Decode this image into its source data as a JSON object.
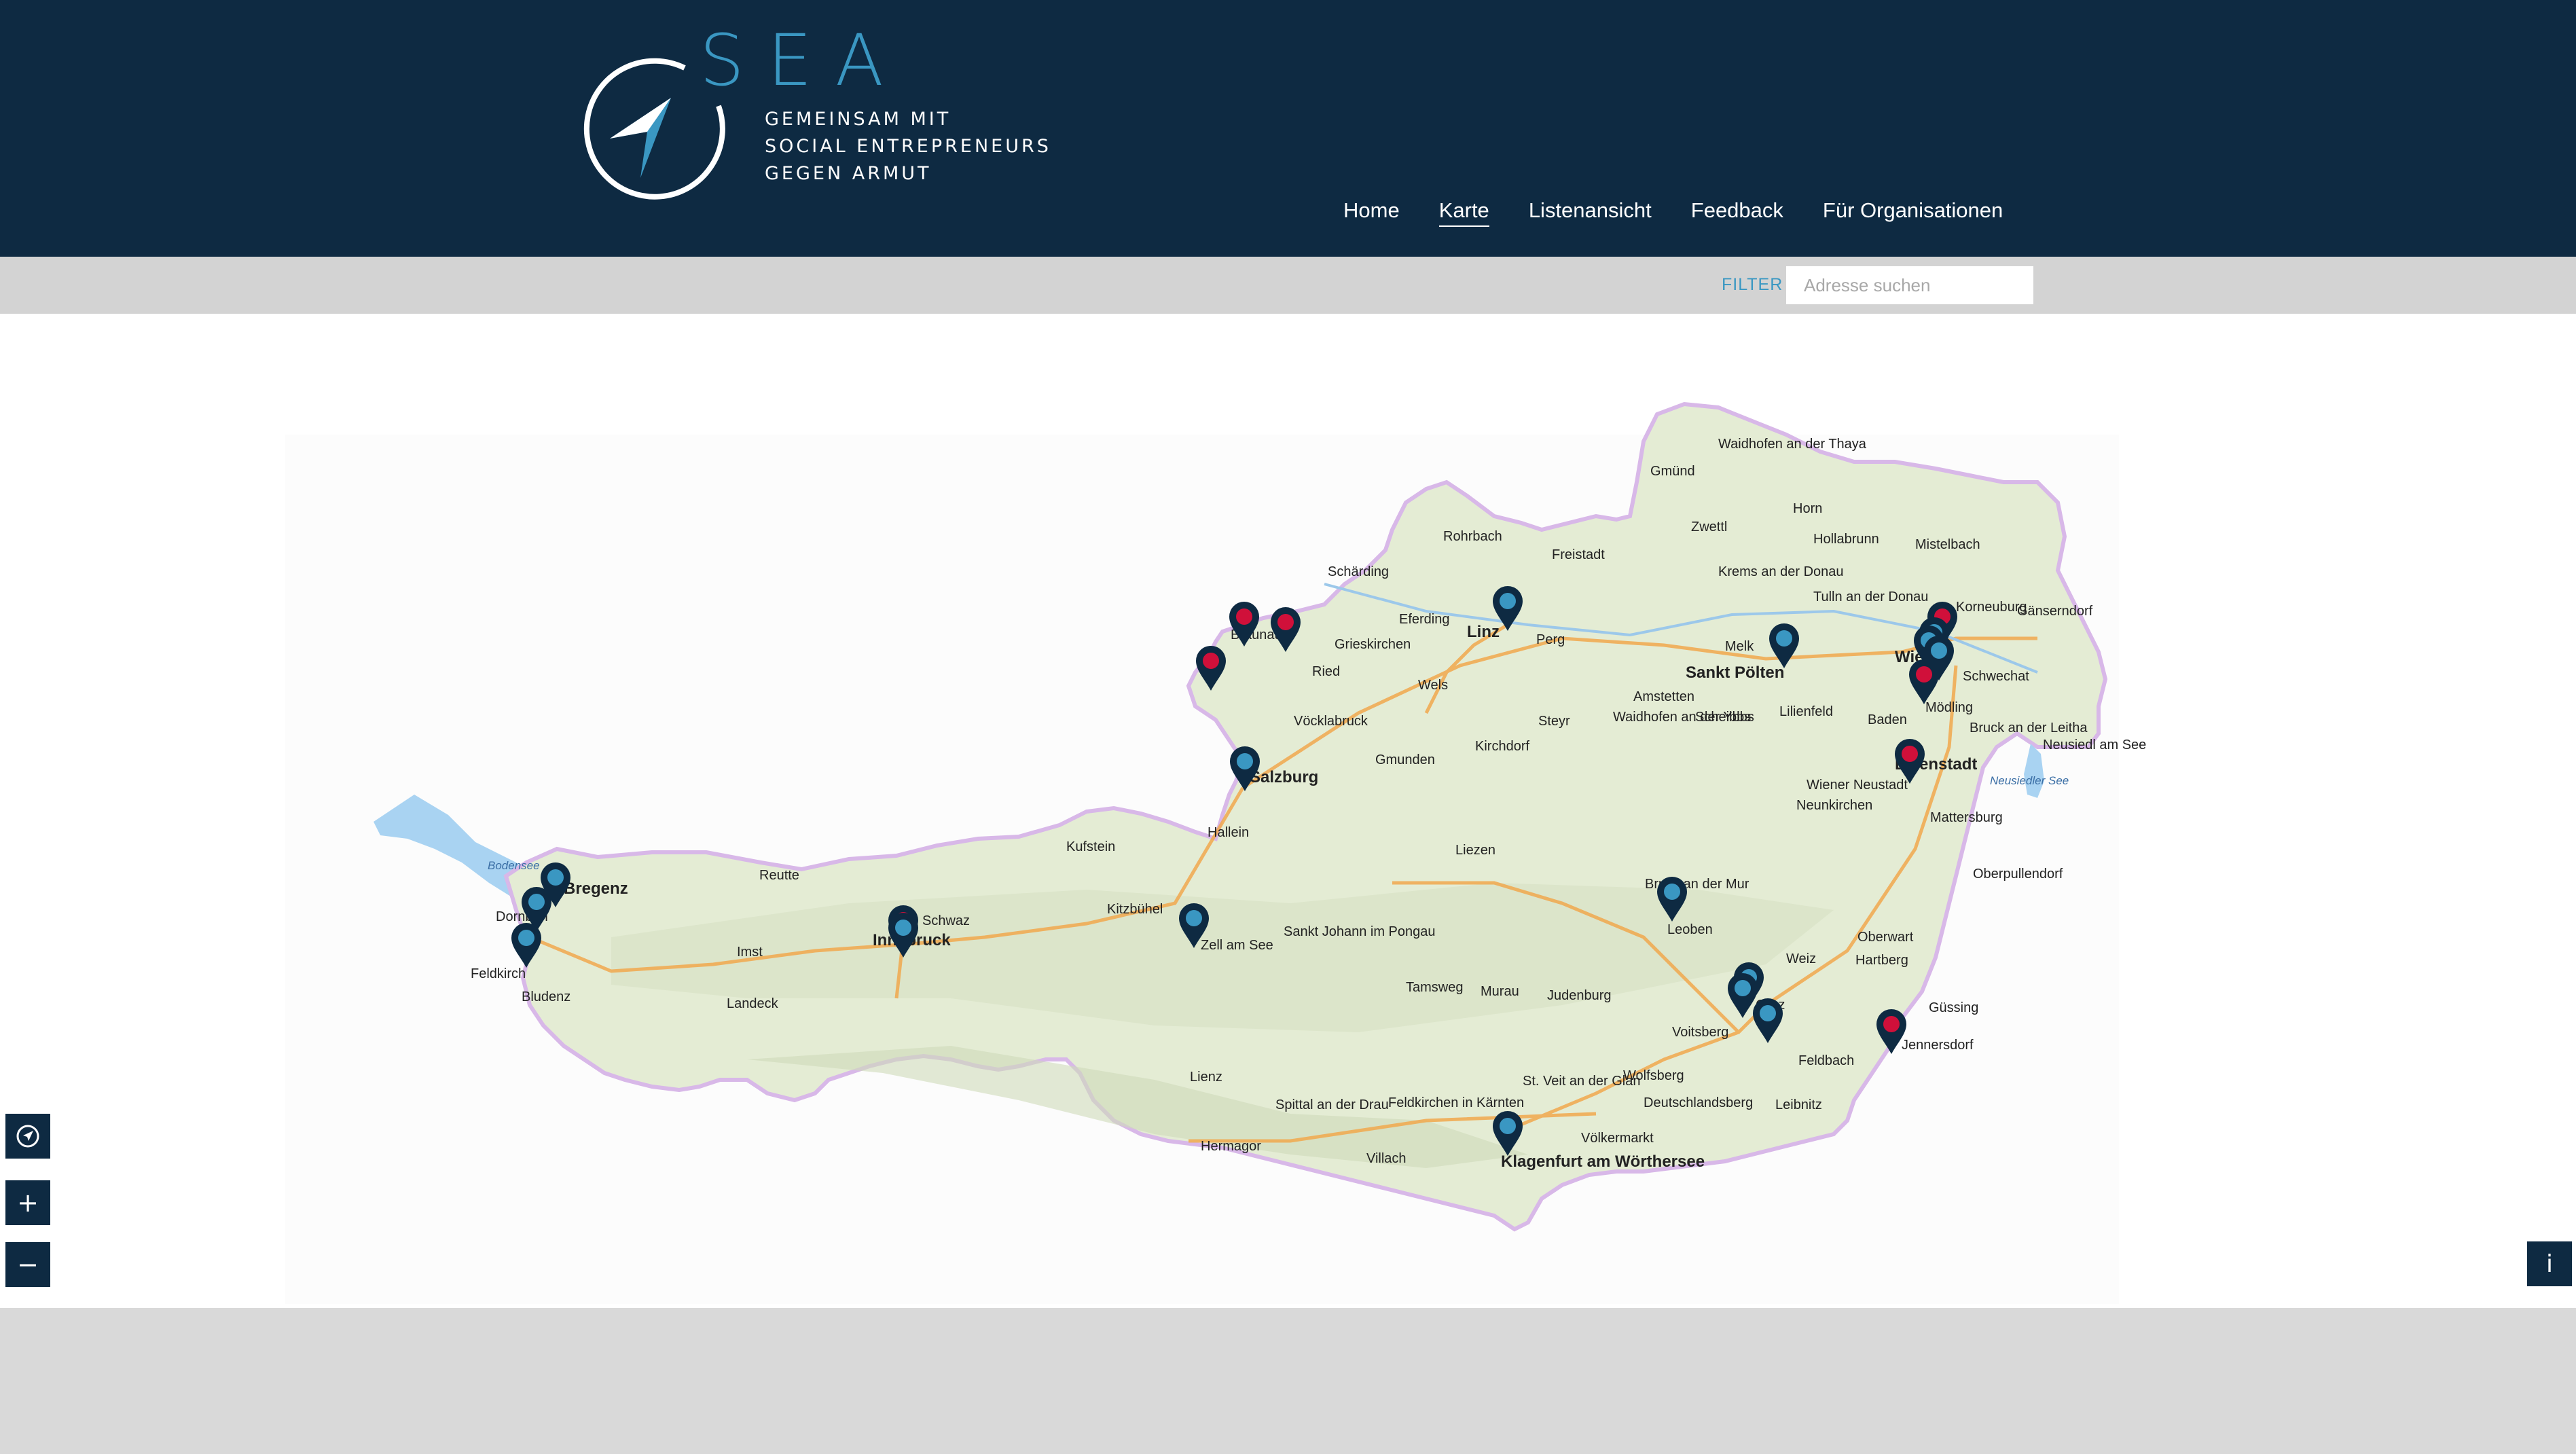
{
  "header": {
    "logo_title": "SEA",
    "tagline": [
      "GEMEINSAM MIT",
      "SOCIAL ENTREPRENEURS",
      "GEGEN ARMUT"
    ]
  },
  "nav": {
    "items": [
      {
        "label": "Home",
        "active": false
      },
      {
        "label": "Karte",
        "active": true
      },
      {
        "label": "Listenansicht",
        "active": false
      },
      {
        "label": "Feedback",
        "active": false
      },
      {
        "label": "Für Organisationen",
        "active": false
      }
    ]
  },
  "filter": {
    "label": "FILTER",
    "search_placeholder": "Adresse suchen"
  },
  "map": {
    "cities": [
      "Waidhofen an der Thaya",
      "Gmünd",
      "Horn",
      "Zwettl",
      "Hollabrunn",
      "Mistelbach",
      "Rohrbach",
      "Freistadt",
      "Krems an der Donau",
      "Tulln an der Donau",
      "Korneuburg",
      "Gänserndorf",
      "Schärding",
      "Braunau",
      "Linz",
      "Perg",
      "Melk",
      "Wien",
      "Eferding",
      "Grieskirchen",
      "Ried",
      "Wels",
      "Sankt Pölten",
      "Schwechat",
      "Amstetten",
      "Mödling",
      "Vöcklabruck",
      "Gmunden",
      "Steyr",
      "Kirchdorf",
      "Waidhofen an der Ybbs",
      "Scheibbs",
      "Lilienfeld",
      "Baden",
      "Bruck an der Leitha",
      "Neusiedl am See",
      "Salzburg",
      "Eisenstadt",
      "Wiener Neustadt",
      "Neunkirchen",
      "Mattersburg",
      "Hallein",
      "Bregenz",
      "Dornbirn",
      "Kufstein",
      "Reutte",
      "Kitzbühel",
      "Liezen",
      "Oberpullendorf",
      "Innsbruck",
      "Schwaz",
      "Zell am See",
      "Sankt Johann im Pongau",
      "Bruck an der Mur",
      "Leoben",
      "Oberwart",
      "Imst",
      "Feldkirch",
      "Bludenz",
      "Landeck",
      "Tamsweg",
      "Murau",
      "Judenburg",
      "Weiz",
      "Hartberg",
      "Graz",
      "Voitsberg",
      "Güssing",
      "Jennersdorf",
      "Feldbach",
      "Lienz",
      "St. Veit an der Glan",
      "Wolfsberg",
      "Deutschlandsberg",
      "Leibnitz",
      "Spittal an der Drau",
      "Feldkirchen in Kärnten",
      "Hermagor",
      "Völkermarkt",
      "Villach",
      "Klagenfurt am Wörthersee"
    ],
    "lake_labels": [
      "Bodensee",
      "Neusiedler See"
    ],
    "marker_colors": {
      "blue": "#3a97c2",
      "red": "#d0103a",
      "pin": "#0e2a42"
    }
  },
  "controls": {
    "locate": "locate-icon",
    "zoom_in": "+",
    "zoom_out": "−",
    "info": "i"
  }
}
